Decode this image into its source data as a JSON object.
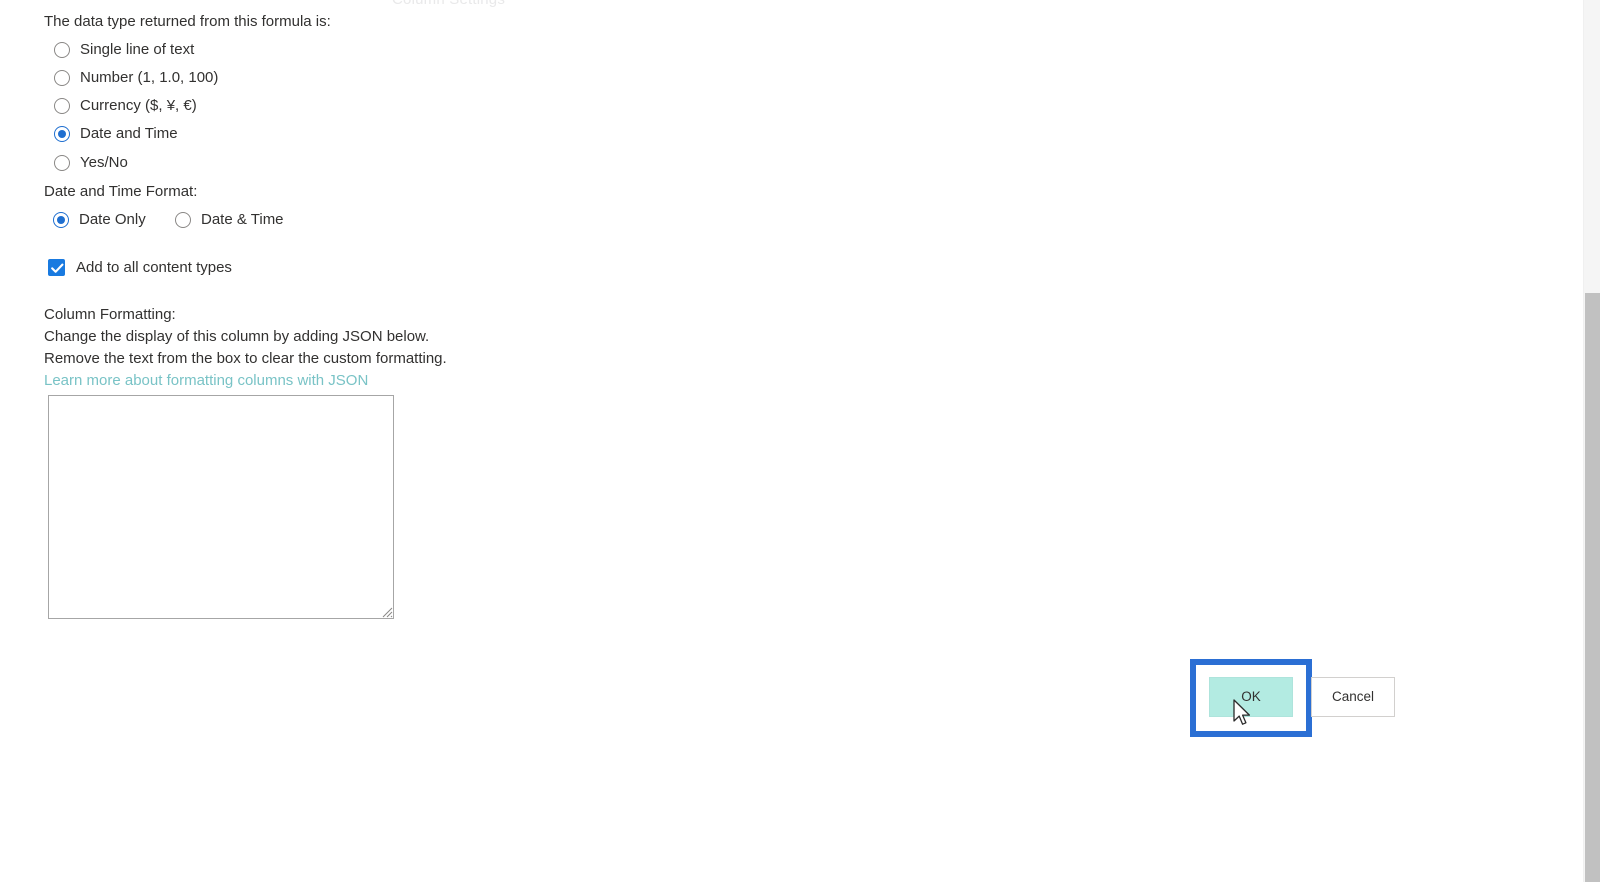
{
  "dialog": {
    "clipped_top_text": "Column Settings",
    "data_type_prompt": "The data type returned from this formula is:",
    "data_type_options": [
      {
        "label": "Single line of text",
        "checked": false
      },
      {
        "label": "Number (1, 1.0, 100)",
        "checked": false
      },
      {
        "label": "Currency ($, ¥, €)",
        "checked": false
      },
      {
        "label": "Date and Time",
        "checked": true
      },
      {
        "label": "Yes/No",
        "checked": false
      }
    ],
    "date_format_label": "Date and Time Format:",
    "date_format_options": [
      {
        "label": "Date Only",
        "checked": true
      },
      {
        "label": "Date & Time",
        "checked": false
      }
    ],
    "add_to_all_content_types": {
      "label": "Add to all content types",
      "checked": true
    },
    "column_formatting": {
      "heading": "Column Formatting:",
      "description_line1": "Change the display of this column by adding JSON below.",
      "description_line2": "Remove the text from the box to clear the custom formatting.",
      "link_label": "Learn more about formatting columns with JSON",
      "textarea_value": "",
      "textarea_placeholder": ""
    },
    "buttons": {
      "ok_label": "OK",
      "cancel_label": "Cancel"
    }
  },
  "colors": {
    "accent_blue": "#1f6fd0",
    "checkbox_blue": "#197ae0",
    "highlight_blue": "#2b6fd4",
    "ok_button_mint": "#b3ebe2",
    "link_teal": "#79c3c6",
    "text_primary": "#323130",
    "scrollbar_thumb": "#c1c1c1",
    "scrollbar_track": "#f5f5f5"
  }
}
